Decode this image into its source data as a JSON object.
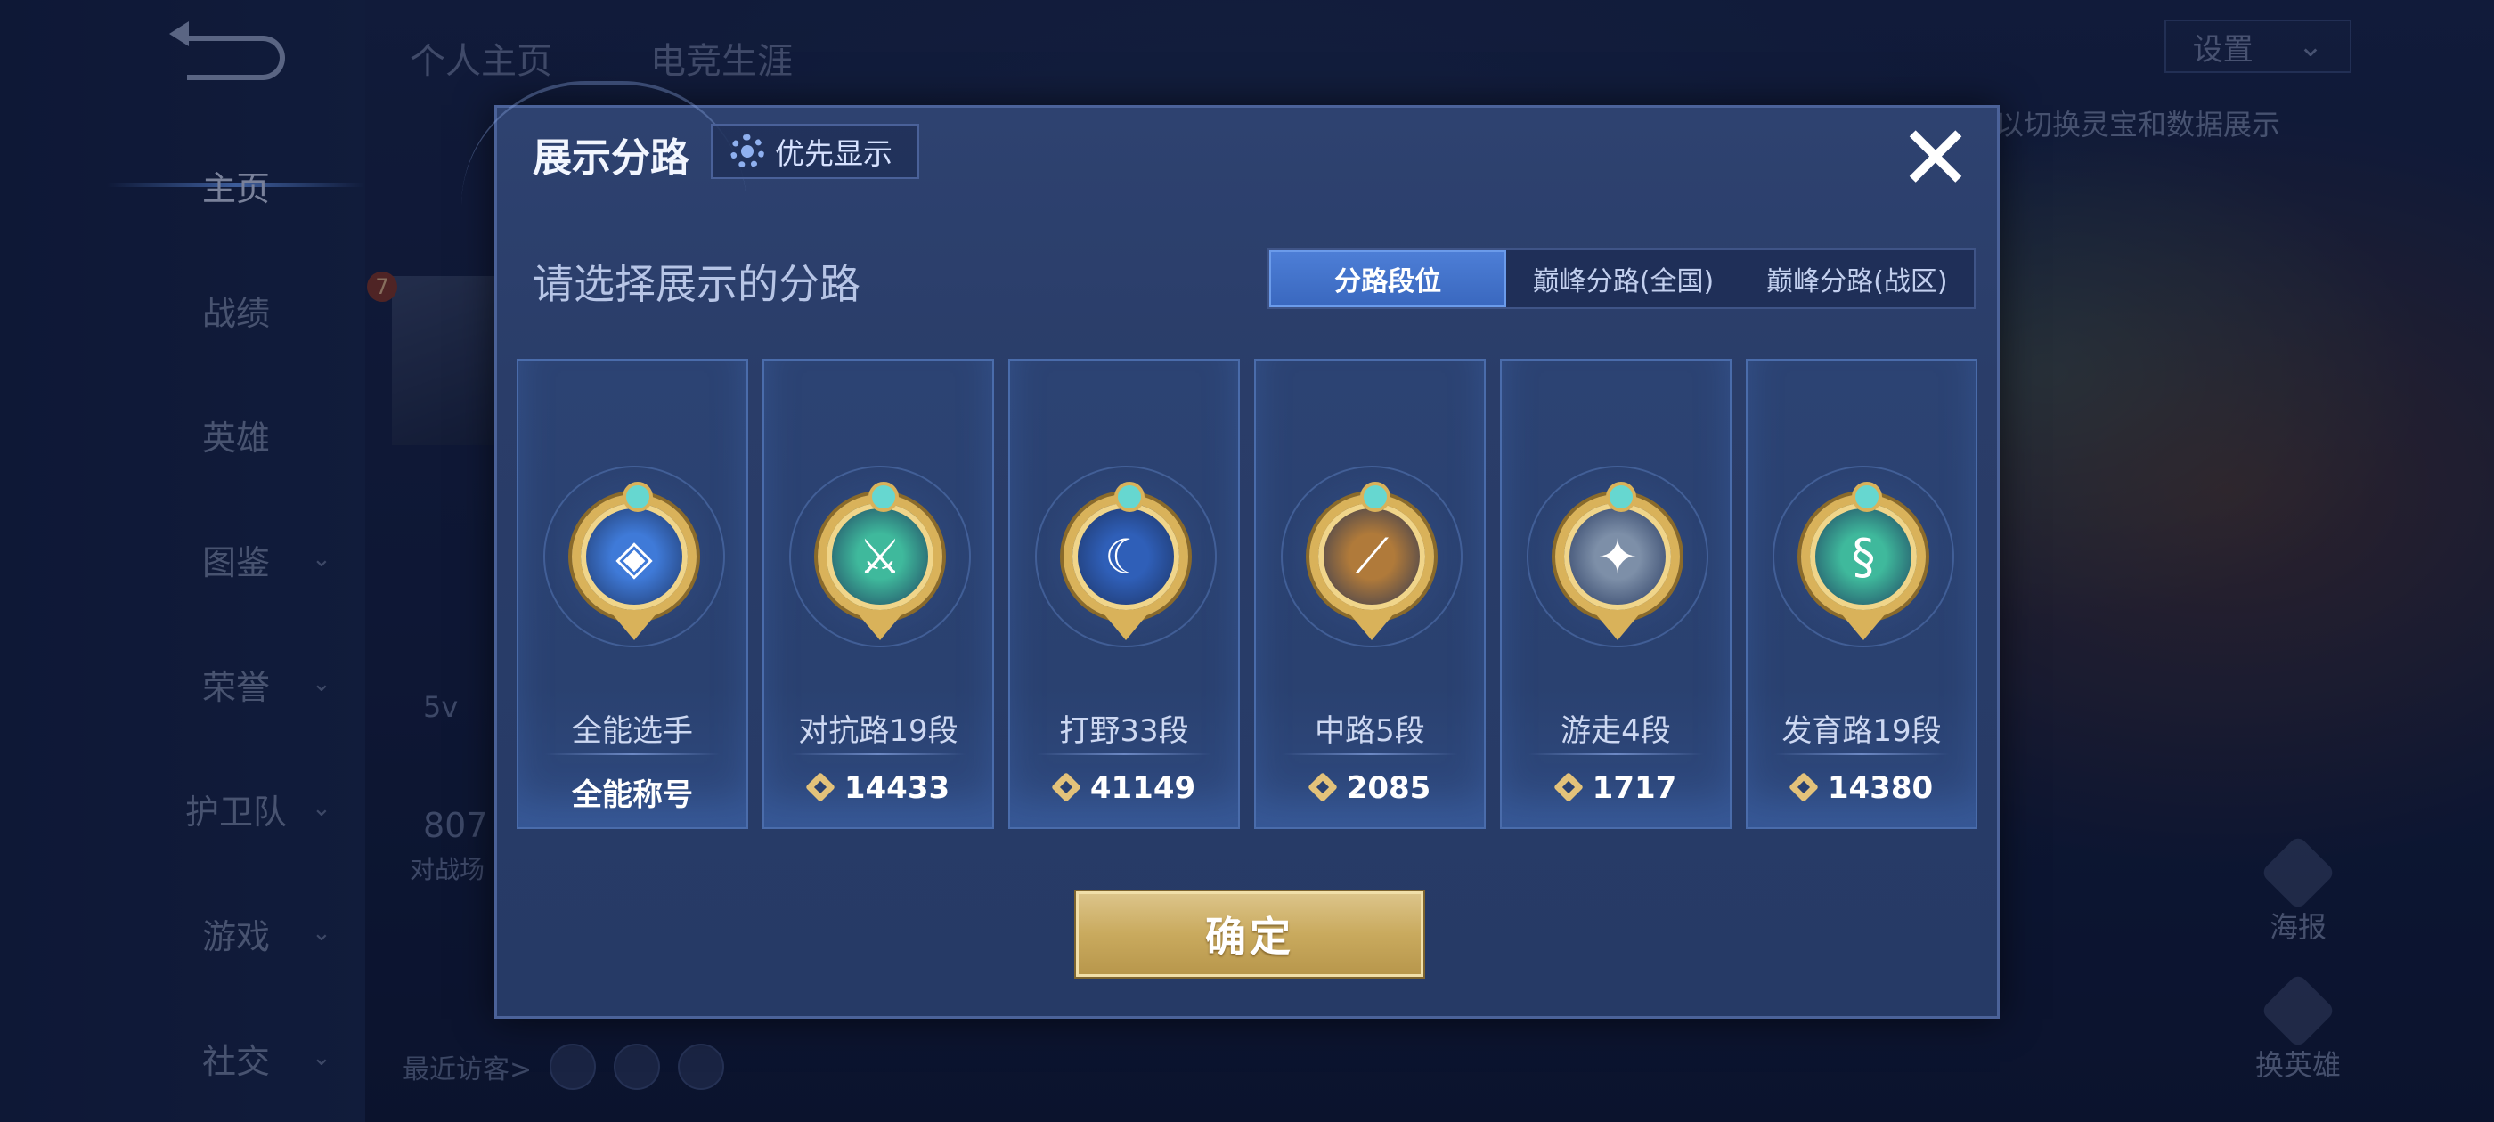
{
  "background": {
    "nav": [
      {
        "label": "主页",
        "chevron": false,
        "active": true
      },
      {
        "label": "战绩",
        "chevron": false
      },
      {
        "label": "英雄",
        "chevron": false
      },
      {
        "label": "图鉴",
        "chevron": true
      },
      {
        "label": "荣誉",
        "chevron": true
      },
      {
        "label": "护卫队",
        "chevron": true
      },
      {
        "label": "游戏",
        "chevron": true
      },
      {
        "label": "社交",
        "chevron": true
      }
    ],
    "tabs": [
      "个人主页",
      "电竞生涯"
    ],
    "settings_label": "设置",
    "hint": "以切换灵宝和数据展示",
    "poster_label": "海报",
    "change_hero_label": "换英雄",
    "recent_visitors": "最近访客>",
    "stat_partial": "807",
    "stat_label_partial": "对战场",
    "level_badge": "7",
    "mode_partial": "5v"
  },
  "modal": {
    "title": "展示分路",
    "priority_label": "优先显示",
    "close_glyph": "✕",
    "subtitle": "请选择展示的分路",
    "segments": [
      "分路段位",
      "巅峰分路(全国)",
      "巅峰分路(战区)"
    ],
    "active_segment": 0,
    "cards": [
      {
        "name": "全能选手",
        "value": "全能称号",
        "has_icon": false,
        "emblem": "◈",
        "emblem_color": "#3f7ad8"
      },
      {
        "name": "对抗路19段",
        "value": "14433",
        "has_icon": true,
        "emblem": "⚔",
        "emblem_color": "#3fb99c"
      },
      {
        "name": "打野33段",
        "value": "41149",
        "has_icon": true,
        "emblem": "☾",
        "emblem_color": "#2f5fb8"
      },
      {
        "name": "中路5段",
        "value": "2085",
        "has_icon": true,
        "emblem": "⟋",
        "emblem_color": "#b07a3a"
      },
      {
        "name": "游走4段",
        "value": "1717",
        "has_icon": true,
        "emblem": "✦",
        "emblem_color": "#7d8fa8"
      },
      {
        "name": "发育路19段",
        "value": "14380",
        "has_icon": true,
        "emblem": "§",
        "emblem_color": "#3fb99c"
      }
    ],
    "confirm_label": "确定"
  }
}
